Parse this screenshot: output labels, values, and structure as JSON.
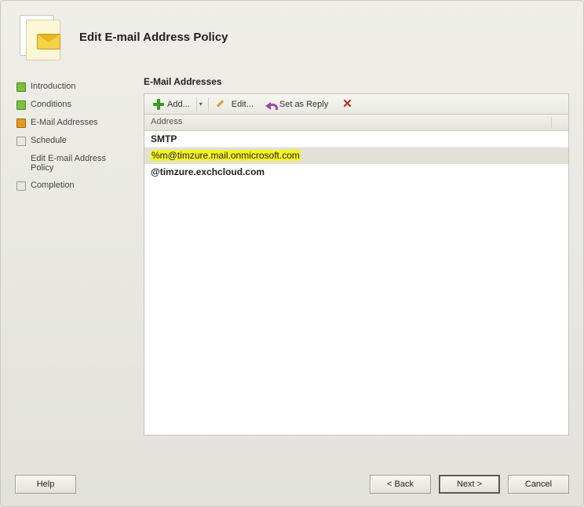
{
  "title": "Edit E-mail Address Policy",
  "steps": [
    {
      "label": "Introduction",
      "state": "done"
    },
    {
      "label": "Conditions",
      "state": "done"
    },
    {
      "label": "E-Mail Addresses",
      "state": "active"
    },
    {
      "label": "Schedule",
      "state": "pending"
    },
    {
      "label": "Edit E-mail Address Policy",
      "state": "nobox"
    },
    {
      "label": "Completion",
      "state": "pending"
    }
  ],
  "section_title": "E-Mail Addresses",
  "toolbar": {
    "add": "Add...",
    "edit": "Edit...",
    "set_reply": "Set as Reply"
  },
  "column_header": "Address",
  "group": "SMTP",
  "rows": [
    {
      "text": "%m@timzure.mail.onmicrosoft.com",
      "selected": true,
      "highlight": true,
      "bold": false
    },
    {
      "text": "@timzure.exchcloud.com",
      "selected": false,
      "highlight": false,
      "bold": true
    }
  ],
  "buttons": {
    "help": "Help",
    "back": "< Back",
    "next": "Next >",
    "cancel": "Cancel"
  }
}
